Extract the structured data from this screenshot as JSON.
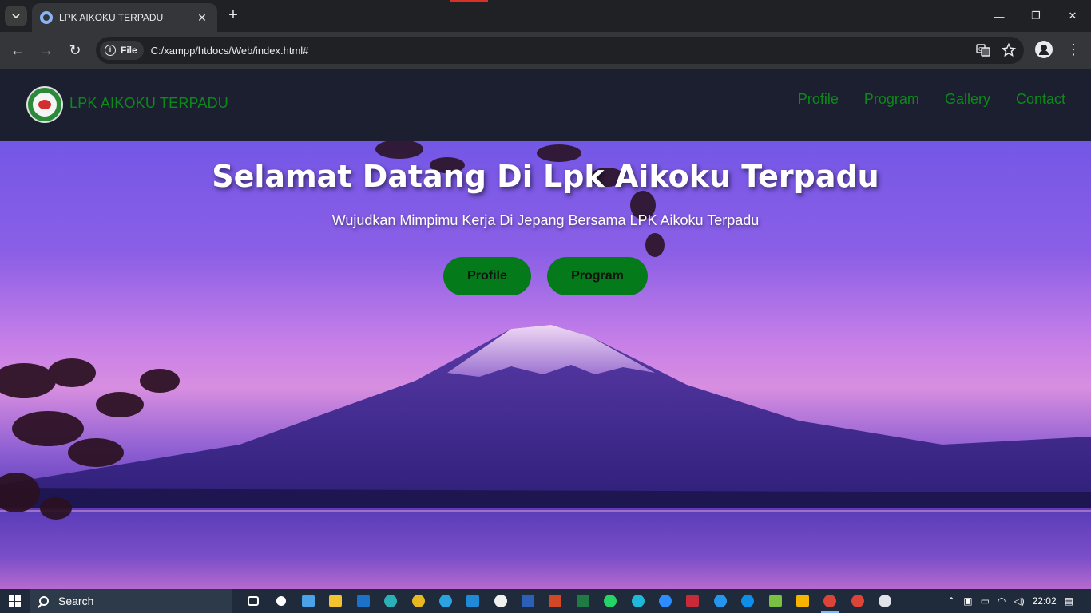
{
  "browser": {
    "tab_title": "LPK AIKOKU TERPADU",
    "new_tab": "+",
    "close_tab": "✕",
    "window": {
      "minimize": "—",
      "restore": "❐",
      "close": "✕"
    },
    "back": "←",
    "forward": "→",
    "reload": "↻",
    "site_chip_label": "File",
    "url": "C:/xampp/htdocs/Web/index.html#",
    "menu": "⋮"
  },
  "site": {
    "brand": "LPK AIKOKU TERPADU",
    "nav": [
      "Profile",
      "Program",
      "Gallery",
      "Contact"
    ],
    "hero": {
      "title": "Selamat Datang Di Lpk Aikoku Terpadu",
      "subtitle": "Wujudkan Mimpimu Kerja Di Jepang Bersama LPK Aikoku Terpadu",
      "buttons": [
        "Profile",
        "Program"
      ]
    },
    "colors": {
      "accent_green": "#0b8a1a",
      "button_green": "#047a1a",
      "nav_bg": "#1b1f30"
    }
  },
  "taskbar": {
    "search_label": "Search",
    "clock": "22:02"
  }
}
